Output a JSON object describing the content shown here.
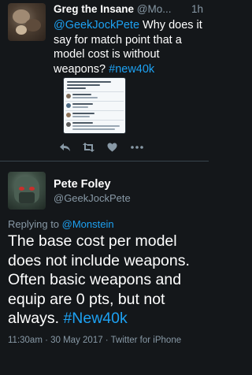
{
  "tweet1": {
    "name": "Greg the Insane",
    "handle": "@Mo...",
    "time": "1h",
    "mention": "@GeekJockPete",
    "text": " Why does it say for match point that a model cost is without weapons? ",
    "hashtag": "#new40k",
    "actions": {
      "reply_icon": "reply-icon",
      "retweet_icon": "retweet-icon",
      "like_icon": "heart-icon",
      "more_icon": "more-icon"
    }
  },
  "tweet2": {
    "name": "Pete Foley",
    "handle": "@GeekJockPete",
    "replying_label": "Replying to ",
    "replying_handle": "@Monstein",
    "text": "The base cost per model does not include weapons. Often basic weapons and equip are 0 pts, but not always. ",
    "hashtag": "#New40k",
    "meta": "11:30am · 30 May 2017 · Twitter for iPhone"
  },
  "colors": {
    "background": "#14171a",
    "link": "#1da1f2",
    "muted": "#8899a6"
  }
}
